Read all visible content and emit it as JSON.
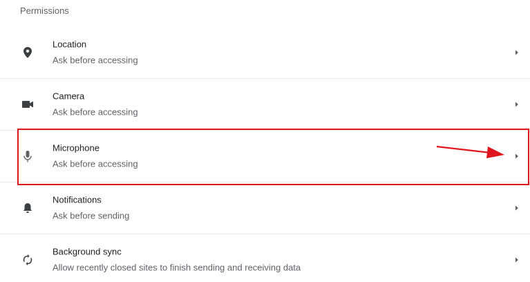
{
  "section": {
    "title": "Permissions"
  },
  "permissions": [
    {
      "label": "Location",
      "sub": "Ask before accessing",
      "icon": "location-pin-icon"
    },
    {
      "label": "Camera",
      "sub": "Ask before accessing",
      "icon": "camera-icon"
    },
    {
      "label": "Microphone",
      "sub": "Ask before accessing",
      "icon": "microphone-icon"
    },
    {
      "label": "Notifications",
      "sub": "Ask before sending",
      "icon": "bell-icon"
    },
    {
      "label": "Background sync",
      "sub": "Allow recently closed sites to finish sending and receiving data",
      "icon": "sync-icon"
    }
  ],
  "annotation": {
    "highlight_color": "#e0161f"
  },
  "colors": {
    "icon": "#5f6368",
    "divider": "#e8eaed"
  }
}
